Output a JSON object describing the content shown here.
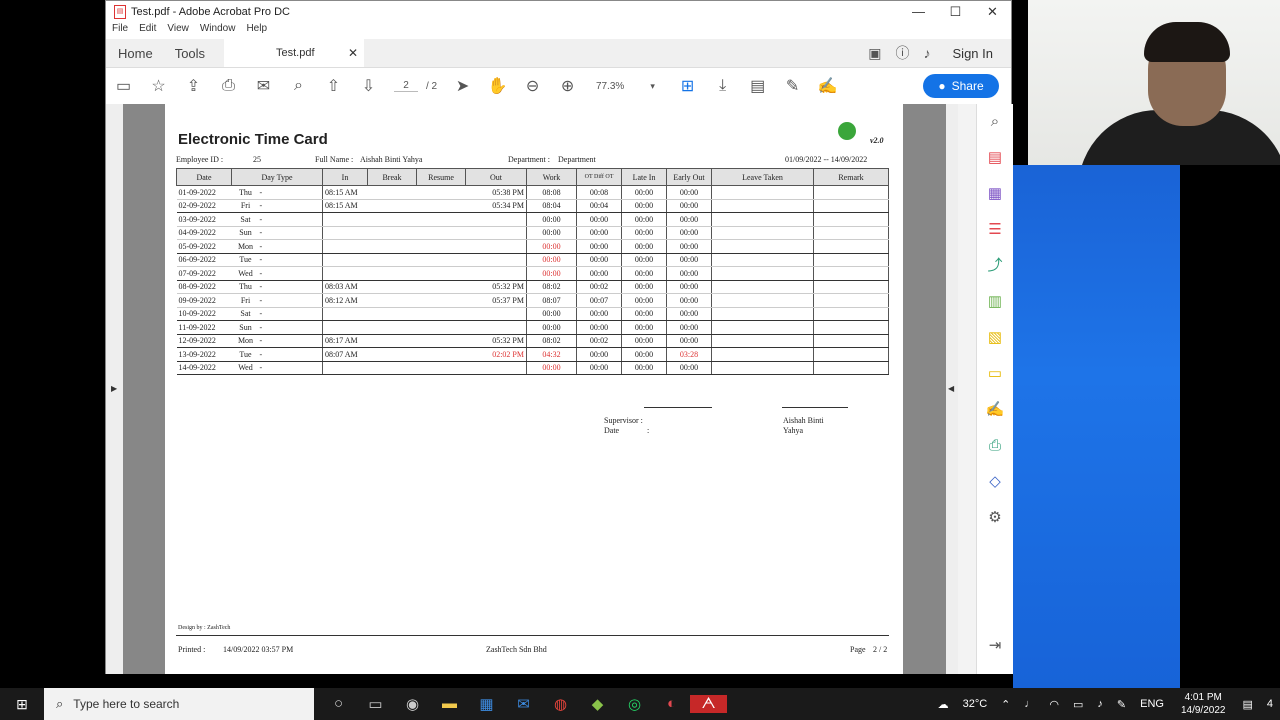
{
  "window": {
    "title": "Test.pdf - Adobe Acrobat Pro DC",
    "menu": [
      "File",
      "Edit",
      "View",
      "Window",
      "Help"
    ],
    "nav_home": "Home",
    "nav_tools": "Tools",
    "doc_tab": "Test.pdf",
    "sign_in": "Sign In",
    "share": "Share",
    "page_current": "2",
    "page_total": "/ 2",
    "zoom": "77.3%"
  },
  "doc": {
    "title": "Electronic Time Card",
    "version": "v2.0",
    "employee_id_label": "Employee ID :",
    "employee_id": "25",
    "full_name_label": "Full Name :",
    "full_name": "Aishah Binti Yahya",
    "department_label": "Department :",
    "department": "Department",
    "period": "01/09/2022  --  14/09/2022",
    "headers": [
      "Date",
      "Day Type",
      "In",
      "Break",
      "Resume",
      "Out",
      "Work",
      "OT Diff OT",
      "Late In",
      "Early Out",
      "Leave Taken",
      "Remark"
    ],
    "rows": [
      {
        "date": "01-09-2022",
        "day": "Thu",
        "type": "-",
        "in": "08:15 AM",
        "out": "05:38 PM",
        "work": "08:08",
        "ot": "00:08",
        "late": "00:00",
        "early": "00:00"
      },
      {
        "date": "02-09-2022",
        "day": "Fri",
        "type": "-",
        "in": "08:15 AM",
        "out": "05:34 PM",
        "work": "08:04",
        "ot": "00:04",
        "late": "00:00",
        "early": "00:00"
      },
      {
        "date": "03-09-2022",
        "day": "Sat",
        "type": "-",
        "in": "",
        "out": "",
        "work": "00:00",
        "ot": "00:00",
        "late": "00:00",
        "early": "00:00"
      },
      {
        "date": "04-09-2022",
        "day": "Sun",
        "type": "-",
        "in": "",
        "out": "",
        "work": "00:00",
        "ot": "00:00",
        "late": "00:00",
        "early": "00:00"
      },
      {
        "date": "05-09-2022",
        "day": "Mon",
        "type": "-",
        "in": "",
        "out": "",
        "work": "00:00",
        "ot": "00:00",
        "late": "00:00",
        "early": "00:00",
        "work_red": true
      },
      {
        "date": "06-09-2022",
        "day": "Tue",
        "type": "-",
        "in": "",
        "out": "",
        "work": "00:00",
        "ot": "00:00",
        "late": "00:00",
        "early": "00:00",
        "work_red": true
      },
      {
        "date": "07-09-2022",
        "day": "Wed",
        "type": "-",
        "in": "",
        "out": "",
        "work": "00:00",
        "ot": "00:00",
        "late": "00:00",
        "early": "00:00",
        "work_red": true
      },
      {
        "date": "08-09-2022",
        "day": "Thu",
        "type": "-",
        "in": "08:03 AM",
        "out": "05:32 PM",
        "work": "08:02",
        "ot": "00:02",
        "late": "00:00",
        "early": "00:00"
      },
      {
        "date": "09-09-2022",
        "day": "Fri",
        "type": "-",
        "in": "08:12 AM",
        "out": "05:37 PM",
        "work": "08:07",
        "ot": "00:07",
        "late": "00:00",
        "early": "00:00"
      },
      {
        "date": "10-09-2022",
        "day": "Sat",
        "type": "-",
        "in": "",
        "out": "",
        "work": "00:00",
        "ot": "00:00",
        "late": "00:00",
        "early": "00:00"
      },
      {
        "date": "11-09-2022",
        "day": "Sun",
        "type": "-",
        "in": "",
        "out": "",
        "work": "00:00",
        "ot": "00:00",
        "late": "00:00",
        "early": "00:00"
      },
      {
        "date": "12-09-2022",
        "day": "Mon",
        "type": "-",
        "in": "08:17 AM",
        "out": "05:32 PM",
        "work": "08:02",
        "ot": "00:02",
        "late": "00:00",
        "early": "00:00"
      },
      {
        "date": "13-09-2022",
        "day": "Tue",
        "type": "-",
        "in": "08:07 AM",
        "out": "02:02 PM",
        "work": "04:32",
        "ot": "00:00",
        "late": "00:00",
        "early": "03:28",
        "out_red": true,
        "work_red": true,
        "early_red": true
      },
      {
        "date": "14-09-2022",
        "day": "Wed",
        "type": "-",
        "in": "",
        "out": "",
        "work": "00:00",
        "ot": "00:00",
        "late": "00:00",
        "early": "00:00",
        "work_red": true
      }
    ],
    "supervisor_label": "Supervisor :",
    "date_label": "Date",
    "colon": ":",
    "signer_line1": "Aishah Binti",
    "signer_line2": "Yahya",
    "design_by": "Design by : ZashTech",
    "printed_label": "Printed :",
    "printed_value": "14/09/2022 03:57 PM",
    "company": "ZashTech Sdn Bhd",
    "page_label": "Page",
    "page_value": "2 / 2"
  },
  "taskbar": {
    "search_placeholder": "Type here to search",
    "weather": "32°C",
    "lang": "ENG",
    "time": "4:01 PM",
    "date": "14/9/2022",
    "notif_count": "4"
  }
}
